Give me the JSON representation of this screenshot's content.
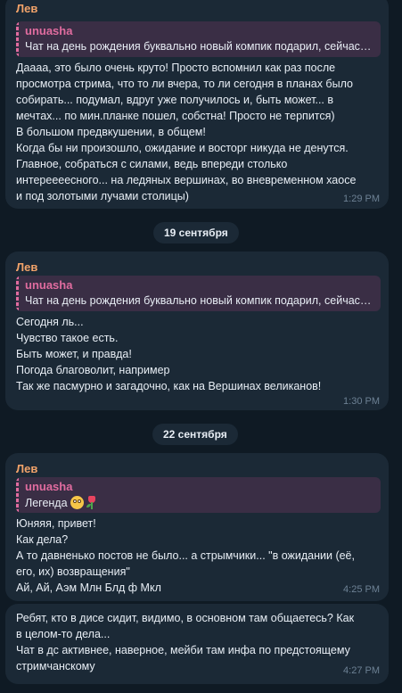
{
  "messages": [
    {
      "sender": "Лев",
      "reply": {
        "name": "unuasha",
        "text": "Чат на день рождения буквально новый компик подарил, сейчас буду ставить игры"
      },
      "lines": [
        "Даааа, это было очень круто! Просто вспомнил как раз после",
        "просмотра стрима, что то ли вчера, то ли сегодня в планах было",
        "собирать... подумал, вдруг уже получилось и, быть может... в",
        "мечтах... по мин.планке пошел, собстна! Просто не терпится)",
        "В большом предвкушении, в общем!",
        "Когда бы ни произошло, ожидание и восторг никуда не денутся.",
        "Главное, собраться с силами, ведь впереди столько",
        "интереееесного... на ледяных вершинах, во вневременном хаосе",
        "и под золотыми лучами столицы)"
      ],
      "time": "1:29 PM"
    },
    {
      "sender": "Лев",
      "reply": {
        "name": "unuasha",
        "text": "Чат на день рождения буквально новый компик подарил, сейчас буду ставить игры"
      },
      "lines": [
        "Сегодня ль...",
        "Чувство такое есть.",
        "Быть может, и правда!",
        "Погода благоволит, например",
        "Так же пасмурно и загадочно, как на Вершинах великанов!"
      ],
      "time": "1:30 PM"
    },
    {
      "sender": "Лев",
      "reply": {
        "name": "unuasha",
        "text": "Легенда"
      },
      "lines": [
        "Юняяя, привет!",
        "Как дела?",
        "А то давненько постов не было... а стрымчики... \"в ожидании (её,",
        "его, их) возвращения\"",
        "Ай, Ай, Аэм Млн Блд ф Мкл"
      ],
      "time": "4:25 PM"
    },
    {
      "lines": [
        "Ребят, кто в дисе сидит, видимо, в основном там общаетесь? Как",
        "в целом-то дела...",
        "Чат в дс активнее, наверное, мейби там инфа по предстоящему",
        "стримчанскому"
      ],
      "time": "4:27 PM"
    }
  ],
  "date_separators": [
    "19 сентября",
    "22 сентября"
  ],
  "icons": {
    "reply_emoji_1": "flushed-face-emoji-icon",
    "reply_emoji_2": "tulip-emoji-icon"
  },
  "colors": {
    "background": "#0f1a24",
    "bubble": "#1b2936",
    "sender": "#f2a36a",
    "reply_accent": "#e06c9f",
    "reply_background": "#3a2e45",
    "time": "#6d8194"
  }
}
